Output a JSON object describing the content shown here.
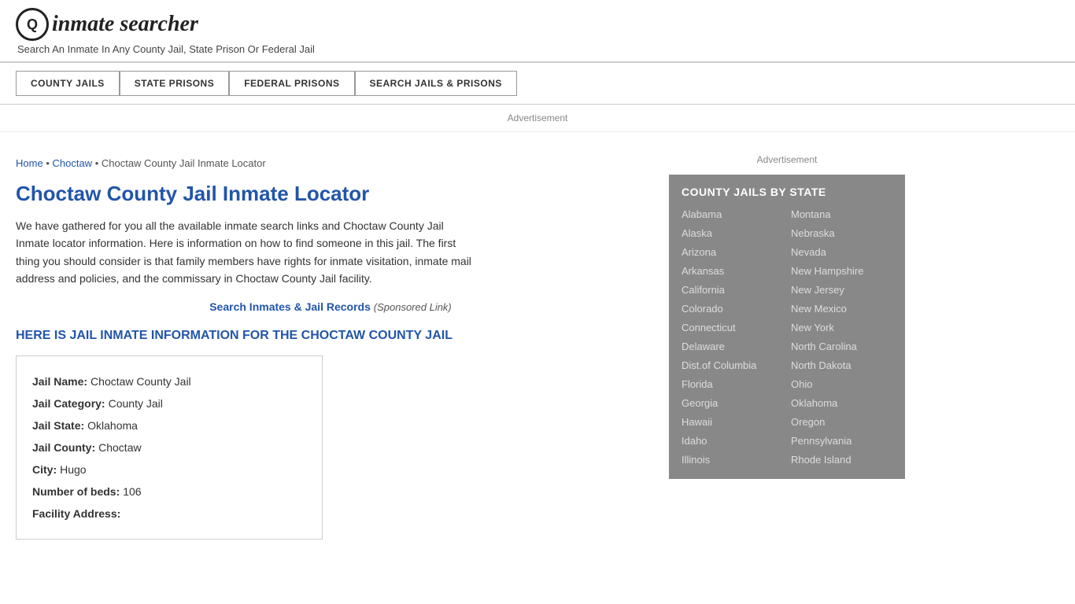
{
  "header": {
    "logo_icon": "Q",
    "logo_text": "inmate searcher",
    "tagline": "Search An Inmate In Any County Jail, State Prison Or Federal Jail"
  },
  "nav": {
    "buttons": [
      {
        "label": "COUNTY JAILS"
      },
      {
        "label": "STATE PRISONS"
      },
      {
        "label": "FEDERAL PRISONS"
      },
      {
        "label": "SEARCH JAILS & PRISONS"
      }
    ]
  },
  "ad_banner": "Advertisement",
  "breadcrumb": {
    "home": "Home",
    "parent": "Choctaw",
    "current": "Choctaw County Jail Inmate Locator"
  },
  "page_title": "Choctaw County Jail Inmate Locator",
  "description": "We have gathered for you all the available inmate search links and Choctaw County Jail Inmate locator information. Here is information on how to find someone in this jail. The first thing you should consider is that family members have rights for inmate visitation, inmate mail address and policies, and the commissary in Choctaw County Jail facility.",
  "sponsored": {
    "link_text": "Search Inmates & Jail Records",
    "suffix": "(Sponsored Link)"
  },
  "section_heading": "HERE IS JAIL INMATE INFORMATION FOR THE CHOCTAW COUNTY JAIL",
  "info_box": {
    "fields": [
      {
        "label": "Jail Name:",
        "value": "Choctaw County Jail"
      },
      {
        "label": "Jail Category:",
        "value": "County Jail"
      },
      {
        "label": "Jail State:",
        "value": "Oklahoma"
      },
      {
        "label": "Jail County:",
        "value": "Choctaw"
      },
      {
        "label": "City:",
        "value": "Hugo"
      },
      {
        "label": "Number of beds:",
        "value": "106"
      },
      {
        "label": "Facility Address:",
        "value": ""
      }
    ]
  },
  "sidebar": {
    "ad_text": "Advertisement",
    "box_title": "COUNTY JAILS BY STATE",
    "states_left": [
      "Alabama",
      "Alaska",
      "Arizona",
      "Arkansas",
      "California",
      "Colorado",
      "Connecticut",
      "Delaware",
      "Dist.of Columbia",
      "Florida",
      "Georgia",
      "Hawaii",
      "Idaho",
      "Illinois"
    ],
    "states_right": [
      "Montana",
      "Nebraska",
      "Nevada",
      "New Hampshire",
      "New Jersey",
      "New Mexico",
      "New York",
      "North Carolina",
      "North Dakota",
      "Ohio",
      "Oklahoma",
      "Oregon",
      "Pennsylvania",
      "Rhode Island"
    ]
  }
}
